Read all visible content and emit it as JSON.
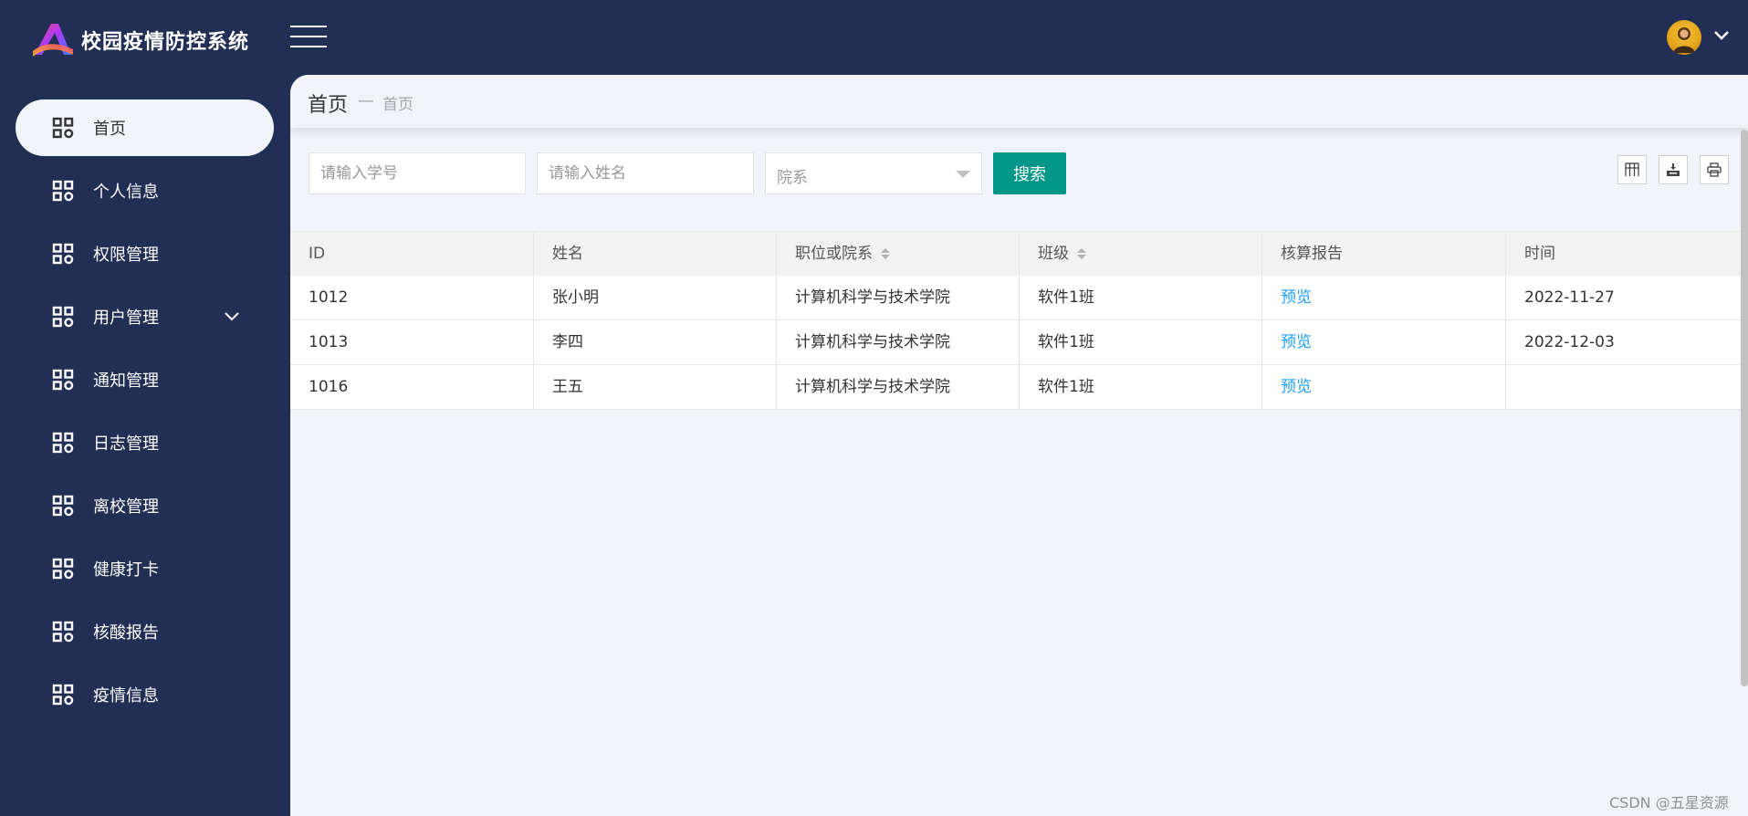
{
  "app": {
    "title": "校园疫情防控系统"
  },
  "sidebar": {
    "items": [
      {
        "label": "首页",
        "active": true
      },
      {
        "label": "个人信息"
      },
      {
        "label": "权限管理"
      },
      {
        "label": "用户管理",
        "has_submenu": true
      },
      {
        "label": "通知管理"
      },
      {
        "label": "日志管理"
      },
      {
        "label": "离校管理"
      },
      {
        "label": "健康打卡"
      },
      {
        "label": "核酸报告"
      },
      {
        "label": "疫情信息"
      }
    ]
  },
  "breadcrumb": {
    "title": "首页",
    "separator": "—",
    "current": "首页"
  },
  "filters": {
    "student_id_placeholder": "请输入学号",
    "name_placeholder": "请输入姓名",
    "department_placeholder": "院系",
    "search_label": "搜索"
  },
  "toolbar": {
    "icons": [
      "columns-icon",
      "export-icon",
      "print-icon"
    ]
  },
  "table": {
    "headers": [
      "ID",
      "姓名",
      "职位或院系",
      "班级",
      "核算报告",
      "时间"
    ],
    "rows": [
      {
        "id": "1012",
        "name": "张小明",
        "department": "计算机科学与技术学院",
        "class": "软件1班",
        "report": "预览",
        "time": "2022-11-27"
      },
      {
        "id": "1013",
        "name": "李四",
        "department": "计算机科学与技术学院",
        "class": "软件1班",
        "report": "预览",
        "time": "2022-12-03"
      },
      {
        "id": "1016",
        "name": "王五",
        "department": "计算机科学与技术学院",
        "class": "软件1班",
        "report": "预览",
        "time": ""
      }
    ]
  },
  "watermark": "CSDN @五星资源",
  "colors": {
    "sidebar_bg": "#222f54",
    "content_bg": "#f0f4f8",
    "primary_button": "#009688",
    "link": "#1e9fff"
  }
}
